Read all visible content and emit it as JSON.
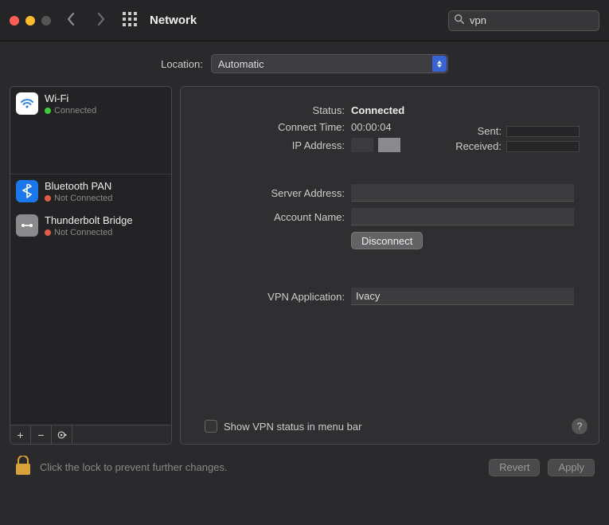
{
  "header": {
    "title": "Network",
    "search_value": "vpn"
  },
  "location": {
    "label": "Location:",
    "selected": "Automatic"
  },
  "sidebar": {
    "services": [
      {
        "name": "Wi-Fi",
        "status": "Connected",
        "dot": "green",
        "icon": "wifi",
        "divider": true
      },
      {
        "name": "Bluetooth PAN",
        "status": "Not Connected",
        "dot": "red",
        "icon": "bt"
      },
      {
        "name": "Thunderbolt Bridge",
        "status": "Not Connected",
        "dot": "red",
        "icon": "tb"
      }
    ],
    "footer": {
      "add": "+",
      "remove": "−"
    }
  },
  "detail": {
    "status_label": "Status:",
    "status_value": "Connected",
    "connect_time_label": "Connect Time:",
    "connect_time_value": "00:00:04",
    "ip_label": "IP Address:",
    "sent_label": "Sent:",
    "received_label": "Received:",
    "server_label": "Server Address:",
    "server_value": "",
    "account_label": "Account Name:",
    "account_value": "",
    "disconnect_label": "Disconnect",
    "vpn_app_label": "VPN Application:",
    "vpn_app_value": "Ivacy",
    "show_status_label": "Show VPN status in menu bar",
    "help": "?"
  },
  "footer": {
    "lock_text": "Click the lock to prevent further changes.",
    "revert": "Revert",
    "apply": "Apply"
  }
}
